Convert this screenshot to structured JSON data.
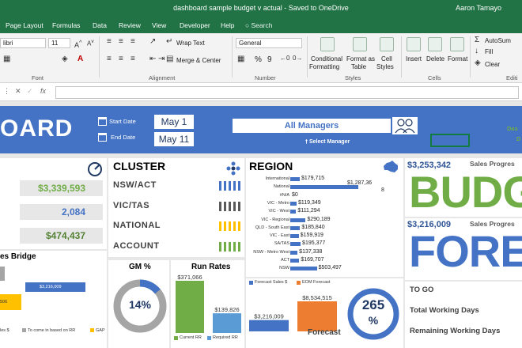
{
  "window": {
    "title": "dashboard sample budget v actual  -  Saved to OneDrive",
    "user": "Aaron Tamayo"
  },
  "tabs": [
    "Page Layout",
    "Formulas",
    "Data",
    "Review",
    "View",
    "Developer",
    "Help"
  ],
  "search_label": "Search",
  "ribbon": {
    "font_name": "libri",
    "font_size": "11",
    "wrap_text": "Wrap Text",
    "merge_center": "Merge & Center",
    "number_format": "General",
    "percent": "%",
    "comma": "9",
    "conditional_formatting": [
      "Conditional",
      "Formatting"
    ],
    "format_as_table": [
      "Format as",
      "Table"
    ],
    "cell_styles": [
      "Cell",
      "Styles"
    ],
    "insert": "Insert",
    "delete": "Delete",
    "format": "Format",
    "autosum": "AutoSum",
    "fill": "Fill",
    "clear": "Clear",
    "groups": {
      "font": "Font",
      "alignment": "Alignment",
      "number": "Number",
      "styles": "Styles",
      "cells": "Cells",
      "editing": "Editi"
    }
  },
  "formula_bar": {
    "fx": "fx"
  },
  "dashboard": {
    "brand": "OARD",
    "start_date_label": "Start Date",
    "end_date_label": "End Date",
    "start_date": "May 1",
    "end_date": "May 11",
    "manager": "All Managers",
    "select_manager": "Select Manager",
    "side_text": [
      "Das",
      "D"
    ]
  },
  "kpis": [
    "$3,339,593",
    "2,084",
    "$474,437"
  ],
  "bridge": {
    "title": "es Bridge",
    "bar_label": "$3,216,009",
    "left_value": "506",
    "legend": [
      "les $",
      "To come in based on RR",
      "GAP"
    ]
  },
  "cluster": {
    "title": "CLUSTER",
    "items": [
      "NSW/ACT",
      "VIC/TAS",
      "NATIONAL",
      "ACCOUNT"
    ],
    "bar_colors": [
      "#4472c4",
      "#595959",
      "#ffc000",
      "#70ad47"
    ]
  },
  "region": {
    "title": "REGION",
    "chart_data": {
      "type": "bar",
      "orientation": "horizontal",
      "categories": [
        "International",
        "National",
        "#N/A",
        "VIC - Metro",
        "VIC - West",
        "VIC - Regional",
        "QLD - South East",
        "VIC - East",
        "SA/TAS",
        "NSW - Metro West",
        "ACT",
        "NSW"
      ],
      "values": [
        179715,
        1287368,
        0,
        119349,
        111294,
        290189,
        185840,
        159919,
        195377,
        137338,
        169707,
        503497
      ],
      "labels": [
        "$179,715",
        "$1,287,36\n8",
        "$0",
        "$119,349",
        "$111,294",
        "$290,189",
        "$185,840",
        "$159,919",
        "$195,377",
        "$137,338",
        "$169,707",
        "$503,497"
      ]
    }
  },
  "gm": {
    "title": "GM %",
    "value": "14%",
    "chart_data": {
      "type": "pie",
      "values": [
        14,
        86
      ]
    }
  },
  "run_rates": {
    "title": "Run Rates",
    "chart_data": {
      "type": "bar",
      "categories": [
        "Current RR",
        "Required RR"
      ],
      "values": [
        371066,
        139826
      ],
      "labels": [
        "$371,066",
        "$139,826"
      ]
    },
    "legend": [
      "Current RR",
      "Required RR"
    ]
  },
  "forecast_panel": {
    "legend": [
      "Forecast Sales $",
      "EOM Forecast"
    ],
    "chart_data": {
      "type": "bar",
      "categories": [
        "Forecast Sales $",
        "EOM Forecast"
      ],
      "values": [
        3216009,
        8534515
      ],
      "labels": [
        "$3,216,009",
        "$8,534,515"
      ]
    },
    "title": "Forecast",
    "gauge_value": "265",
    "gauge_unit": "%"
  },
  "budget": {
    "amount": "$3,253,342",
    "progress_label": "Sales Progres",
    "word": "BUDGET"
  },
  "forecast": {
    "amount": "$3,216,009",
    "progress_label": "Sales Progres",
    "word": "FORECA"
  },
  "stats": [
    "TO GO",
    "Total Working Days",
    "Remaining Working Days"
  ],
  "colors": {
    "excel_green": "#217346",
    "blue": "#4472c4",
    "green": "#70ad47",
    "orange": "#ed7d31",
    "gold": "#ffc000",
    "grey": "#a5a5a5"
  }
}
